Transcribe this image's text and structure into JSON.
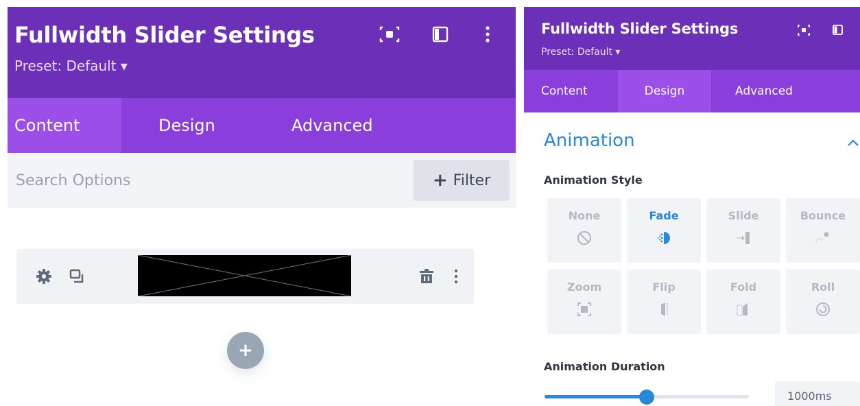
{
  "left_panel": {
    "title": "Fullwidth Slider Settings",
    "preset": "Preset: Default ▾",
    "tabs": [
      {
        "label": "Content",
        "active": true
      },
      {
        "label": "Design",
        "active": false
      },
      {
        "label": "Advanced",
        "active": false
      }
    ],
    "search": {
      "placeholder": "Search Options",
      "value": ""
    },
    "filter_label": "Filter",
    "filter_plus": "+",
    "add_symbol": "+"
  },
  "right_panel": {
    "title": "Fullwidth Slider Settings",
    "preset": "Preset: Default ▾",
    "tabs": [
      {
        "label": "Content",
        "active": false
      },
      {
        "label": "Design",
        "active": true
      },
      {
        "label": "Advanced",
        "active": false
      }
    ],
    "section_title": "Animation",
    "animation_style_label": "Animation Style",
    "animation_styles": [
      {
        "label": "None",
        "icon": "none-icon",
        "active": false
      },
      {
        "label": "Fade",
        "icon": "fade-icon",
        "active": true
      },
      {
        "label": "Slide",
        "icon": "slide-icon",
        "active": false
      },
      {
        "label": "Bounce",
        "icon": "bounce-icon",
        "active": false
      },
      {
        "label": "Zoom",
        "icon": "zoom-icon",
        "active": false
      },
      {
        "label": "Flip",
        "icon": "flip-icon",
        "active": false
      },
      {
        "label": "Fold",
        "icon": "fold-icon",
        "active": false
      },
      {
        "label": "Roll",
        "icon": "roll-icon",
        "active": false
      }
    ],
    "animation_duration_label": "Animation Duration",
    "animation_duration_value": "1000ms",
    "animation_duration_fraction": 0.5
  },
  "colors": {
    "header": "#6b2fb8",
    "tabs": "#8a3fdd",
    "active_tab": "#9b4fe8",
    "accent_blue": "#2b87da",
    "tile_bg": "#f1f3f6"
  }
}
